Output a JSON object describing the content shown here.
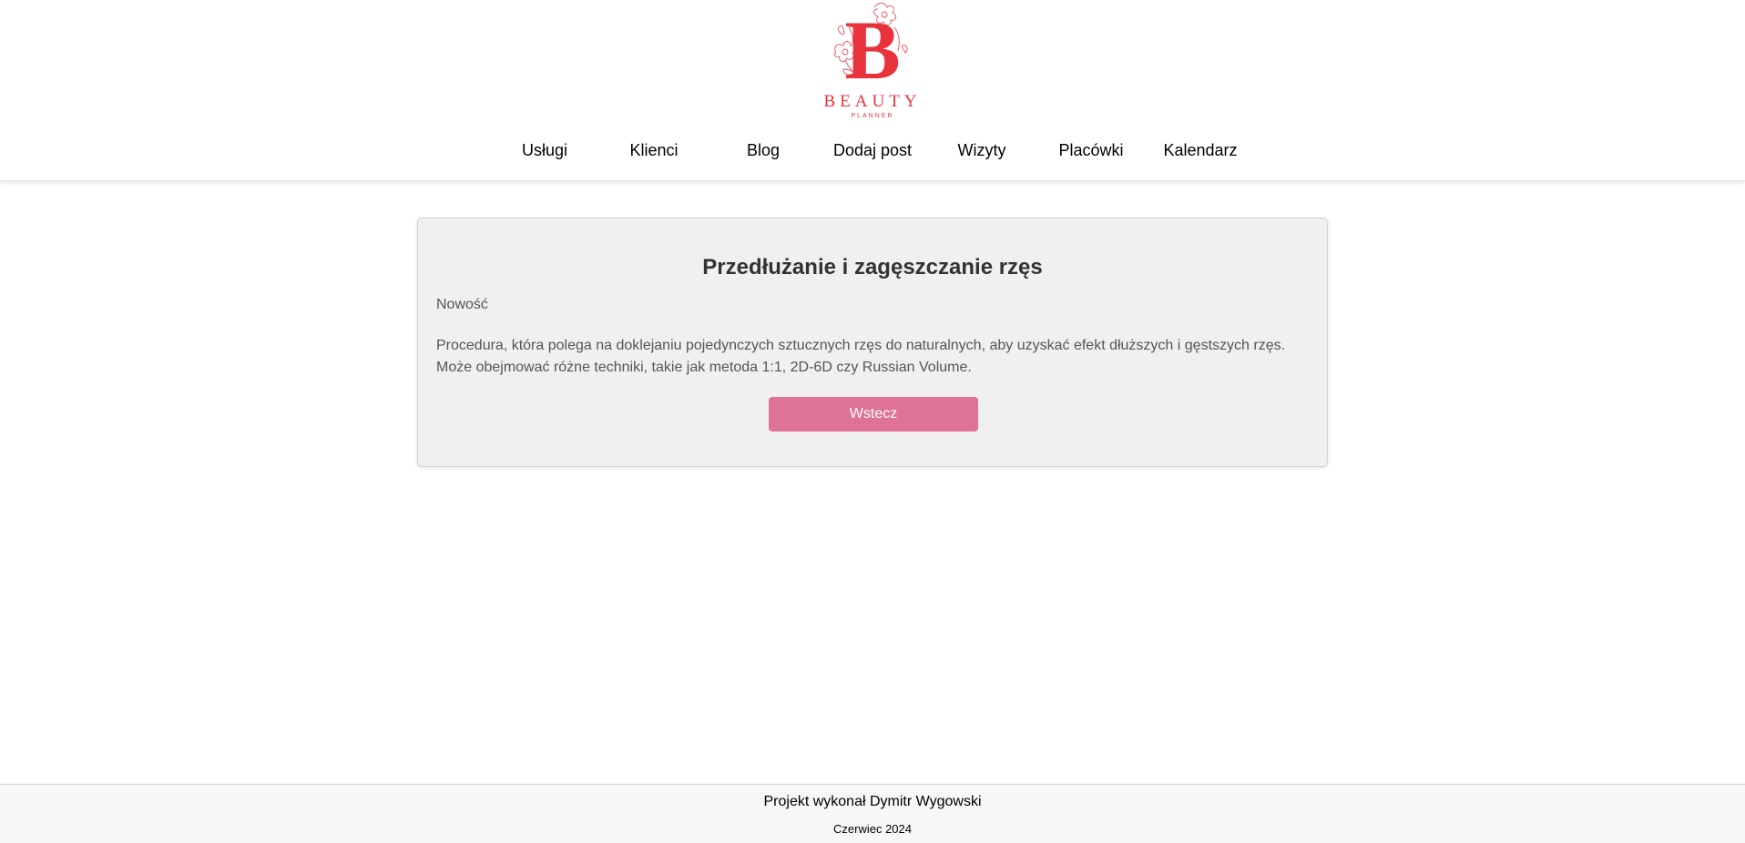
{
  "header": {
    "logo": {
      "letter": "B",
      "word": "BEAUTY",
      "sub": "PLANNER",
      "color": "#e8323c"
    },
    "nav": [
      {
        "label": "Usługi"
      },
      {
        "label": "Klienci"
      },
      {
        "label": "Blog"
      },
      {
        "label": "Dodaj post"
      },
      {
        "label": "Wizyty"
      },
      {
        "label": "Placówki"
      },
      {
        "label": "Kalendarz"
      }
    ]
  },
  "post": {
    "title": "Przedłużanie i zagęszczanie rzęs",
    "category": "Nowość",
    "description": "Procedura, która polega na doklejaniu pojedynczych sztucznych rzęs do naturalnych, aby uzyskać efekt dłuższych i gęstszych rzęs. Może obejmować różne techniki, takie jak metoda 1:1, 2D-6D czy Russian Volume.",
    "back_label": "Wstecz",
    "button_color": "#de7395"
  },
  "footer": {
    "author": "Projekt wykonał Dymitr Wygowski",
    "date": "Czerwiec 2024"
  }
}
